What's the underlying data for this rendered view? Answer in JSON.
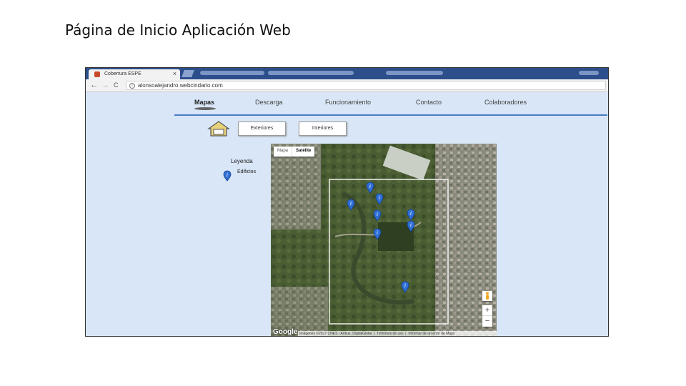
{
  "slide": {
    "title": "Página de Inicio Aplicación Web"
  },
  "browser": {
    "tab_title": "Cobertura ESPE",
    "tab_close": "×",
    "url": "alonsoalejandro.webcindario.com",
    "nav": {
      "back": "←",
      "forward": "→",
      "reload": "C"
    }
  },
  "site": {
    "nav": [
      {
        "label": "Mapas"
      },
      {
        "label": "Descarga"
      },
      {
        "label": "Funcionamiento"
      },
      {
        "label": "Contacto"
      },
      {
        "label": "Colaboradores"
      }
    ],
    "buttons": {
      "exteriores": "Exteriores",
      "interiores": "Interiores"
    },
    "legend": {
      "title": "Leyenda",
      "item_label": "Edificios"
    }
  },
  "map": {
    "type_map": "Mapa",
    "type_satellite": "Satélite",
    "zoom_in": "+",
    "zoom_out": "−",
    "logo": "Google",
    "attribution": [
      "Imágenes ©2017 CNES / Airbus, DigitalGlobe",
      "Términos de uso",
      "Informar de un error de Maps"
    ],
    "marker_icon": "info-marker-icon"
  },
  "colors": {
    "tab_strip": "#2c4f8c",
    "page_background": "#d8e6f7",
    "nav_rule": "#4a7bc4",
    "marker_blue": "#2f6fd6"
  }
}
